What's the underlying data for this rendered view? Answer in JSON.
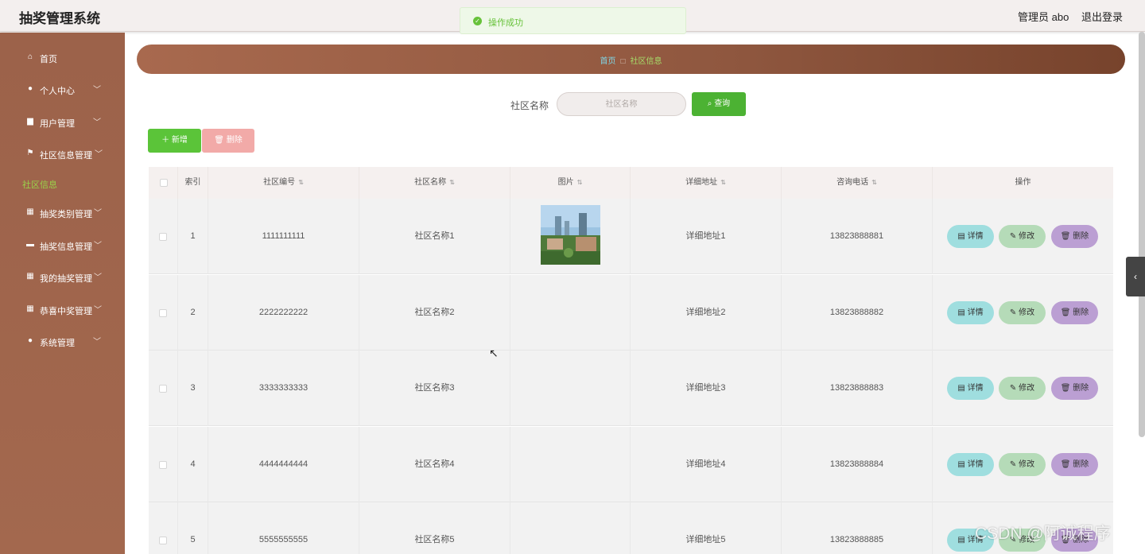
{
  "header": {
    "app_title": "抽奖管理系统",
    "admin_label": "管理员 abo",
    "logout": "退出登录"
  },
  "toast": {
    "text": "操作成功",
    "icon": "check-circle-icon"
  },
  "sidebar": {
    "items": [
      {
        "label": "首页",
        "icon": "home-icon",
        "has_chevron": false
      },
      {
        "label": "个人中心",
        "icon": "user-icon",
        "has_chevron": true
      },
      {
        "label": "用户管理",
        "icon": "folder-icon",
        "has_chevron": true
      },
      {
        "label": "社区信息管理",
        "icon": "flag-icon",
        "has_chevron": true
      },
      {
        "label": "抽奖类别管理",
        "icon": "grid-icon",
        "has_chevron": true
      },
      {
        "label": "抽奖信息管理",
        "icon": "comment-icon",
        "has_chevron": true
      },
      {
        "label": "我的抽奖管理",
        "icon": "grid-icon",
        "has_chevron": true
      },
      {
        "label": "恭喜中奖管理",
        "icon": "grid-icon",
        "has_chevron": true
      },
      {
        "label": "系统管理",
        "icon": "user-icon",
        "has_chevron": true
      }
    ],
    "active_subitem": "社区信息"
  },
  "breadcrumb": {
    "home": "首页",
    "separator": "□",
    "current": "社区信息"
  },
  "search": {
    "label": "社区名称",
    "placeholder": "社区名称",
    "value": "",
    "button": "查询"
  },
  "toolbar": {
    "add": "新增",
    "delete": "删除"
  },
  "table": {
    "columns": [
      "索引",
      "社区编号",
      "社区名称",
      "图片",
      "详细地址",
      "咨询电话",
      "操作"
    ],
    "actions": {
      "detail": "详情",
      "edit": "修改",
      "delete": "删除"
    },
    "rows": [
      {
        "index": "1",
        "code": "1111111111",
        "name": "社区名称1",
        "has_image": true,
        "address": "详细地址1",
        "phone": "13823888881"
      },
      {
        "index": "2",
        "code": "2222222222",
        "name": "社区名称2",
        "has_image": false,
        "address": "详细地址2",
        "phone": "13823888882"
      },
      {
        "index": "3",
        "code": "3333333333",
        "name": "社区名称3",
        "has_image": false,
        "address": "详细地址3",
        "phone": "13823888883"
      },
      {
        "index": "4",
        "code": "4444444444",
        "name": "社区名称4",
        "has_image": false,
        "address": "详细地址4",
        "phone": "13823888884"
      },
      {
        "index": "5",
        "code": "5555555555",
        "name": "社区名称5",
        "has_image": false,
        "address": "详细地址5",
        "phone": "13823888885"
      }
    ]
  },
  "watermark": "CSDN @阿诚程序",
  "colors": {
    "sidebar": "#9b6249",
    "accent_green": "#4cb233",
    "delete_pink": "#f2aaa8"
  }
}
